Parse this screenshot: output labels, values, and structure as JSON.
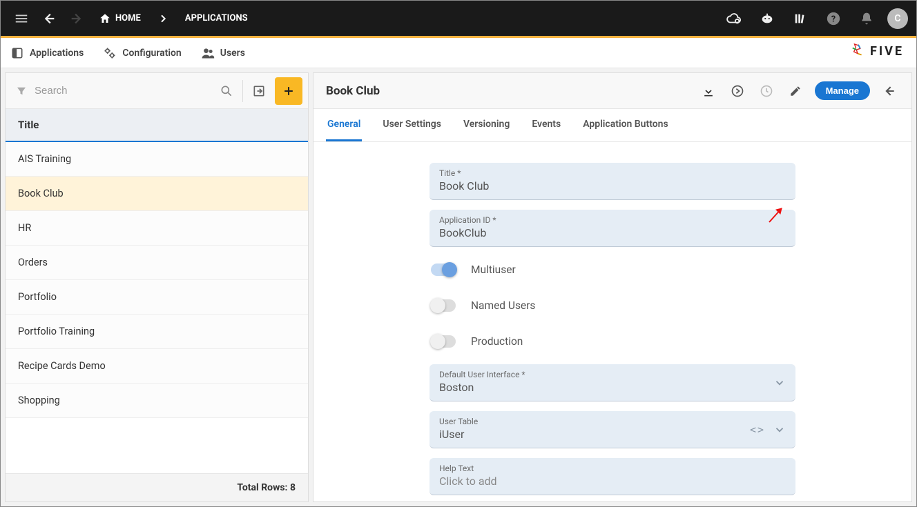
{
  "topbar": {
    "breadcrumbs": [
      {
        "label": "HOME"
      },
      {
        "label": "APPLICATIONS"
      }
    ],
    "avatar_initial": "C"
  },
  "secondnav": {
    "items": [
      {
        "label": "Applications"
      },
      {
        "label": "Configuration"
      },
      {
        "label": "Users"
      }
    ],
    "brand": "FIVE"
  },
  "sidebar": {
    "search_placeholder": "Search",
    "header": "Title",
    "rows": [
      "AIS Training",
      "Book Club",
      "HR",
      "Orders",
      "Portfolio",
      "Portfolio Training",
      "Recipe Cards Demo",
      "Shopping"
    ],
    "selected_index": 1,
    "footer": "Total Rows: 8"
  },
  "detail": {
    "title": "Book Club",
    "manage_label": "Manage",
    "tabs": [
      "General",
      "User Settings",
      "Versioning",
      "Events",
      "Application Buttons"
    ],
    "active_tab": 0,
    "fields": {
      "title": {
        "label": "Title *",
        "value": "Book Club"
      },
      "app_id": {
        "label": "Application ID *",
        "value": "BookClub"
      },
      "multiuser": {
        "label": "Multiuser",
        "on": true
      },
      "named_users": {
        "label": "Named Users",
        "on": false
      },
      "production": {
        "label": "Production",
        "on": false
      },
      "default_ui": {
        "label": "Default User Interface *",
        "value": "Boston"
      },
      "user_table": {
        "label": "User Table",
        "value": "iUser"
      },
      "help_text": {
        "label": "Help Text",
        "placeholder": "Click to add"
      }
    }
  }
}
